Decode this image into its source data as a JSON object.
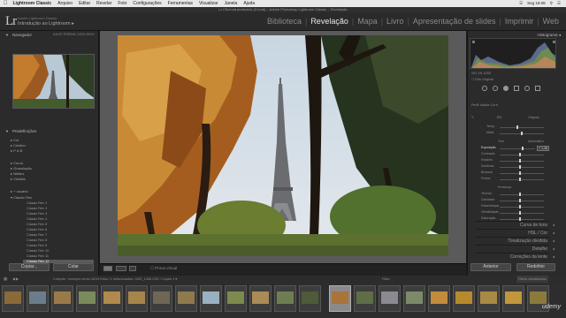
{
  "menubar": {
    "app": "Lightroom Classic",
    "items": [
      "Arquivo",
      "Editar",
      "Revelar",
      "Foto",
      "Configurações",
      "Ferramentas",
      "Visualizar",
      "Janela",
      "Ajuda"
    ],
    "clock": "Seg 18:08"
  },
  "window_title": "Lr Cfb.lrcat produzido (2.lrcat) – Adobe Photoshop Lightroom Classic – Revelação",
  "catalog": {
    "small": "Adobe Lightroom Classic",
    "title": "Introdução ao Lightroom"
  },
  "modules": [
    {
      "label": "Biblioteca"
    },
    {
      "label": "Revelação"
    },
    {
      "label": "Mapa"
    },
    {
      "label": "Livro"
    },
    {
      "label": "Apresentação de slides"
    },
    {
      "label": "Imprimir"
    },
    {
      "label": "Web"
    }
  ],
  "left": {
    "navigator": "Navegador",
    "nav_opts": "AJUST  PREENC  100%  200%",
    "presets_title": "Predefinições",
    "presets": [
      "Cor",
      "Criativo",
      "P & B",
      "Curva",
      "Granulação",
      "Nitidez",
      "Vinheta"
    ],
    "user_group": "+ usuário",
    "user_sub": "Classic Rev",
    "subitems": [
      "Classic Rev 1",
      "Classic Rev 2",
      "Classic Rev 3",
      "Classic Rev 4",
      "Classic Rev 5",
      "Classic Rev 6",
      "Classic Rev 7",
      "Classic Rev 8",
      "Classic Rev 9",
      "Classic Rev 10",
      "Classic Rev 11",
      "Classic Rev 12"
    ],
    "copy": "Copiar...",
    "paste": "Colar"
  },
  "toolbar": {
    "label": "Prova virtual"
  },
  "right": {
    "histogram": "Histograma",
    "raw": "Foto Original",
    "profile_label": "Perfil:",
    "profile": "Adobe Cor",
    "wb": "EB:",
    "wb_val": "Original",
    "temp": "Temp.",
    "tint": "Matiz",
    "tone": "Tom",
    "auto": "Automático",
    "exposure": "Exposição",
    "exposure_val": "+ 1,36",
    "rows": [
      "Contraste",
      "Realces",
      "Sombras",
      "Brancos",
      "Pretos"
    ],
    "presence": "Presença",
    "presence_rows": [
      "Textura",
      "Claridade",
      "Desembaçar",
      "Vibratilidade",
      "Saturação"
    ],
    "sections": [
      "Curva de tons",
      "HSL / Cor",
      "Tonalização dividida",
      "Detalhe",
      "Correções da lente"
    ],
    "previous": "Anterior",
    "reset": "Redefinir"
  },
  "filmbar": {
    "text": "Coleção : exemplo vento     16/19 fotos / 1 selecionadas / IMG_1466.CR2 / Copiar 1 ▾",
    "filter": "Filtro:",
    "filter_val": "Filtros desativados"
  },
  "watermark": "udemy",
  "colors": {
    "accent": "#e6e6e6",
    "panel": "#2b2b2b",
    "bg": "#1c1c1c"
  }
}
